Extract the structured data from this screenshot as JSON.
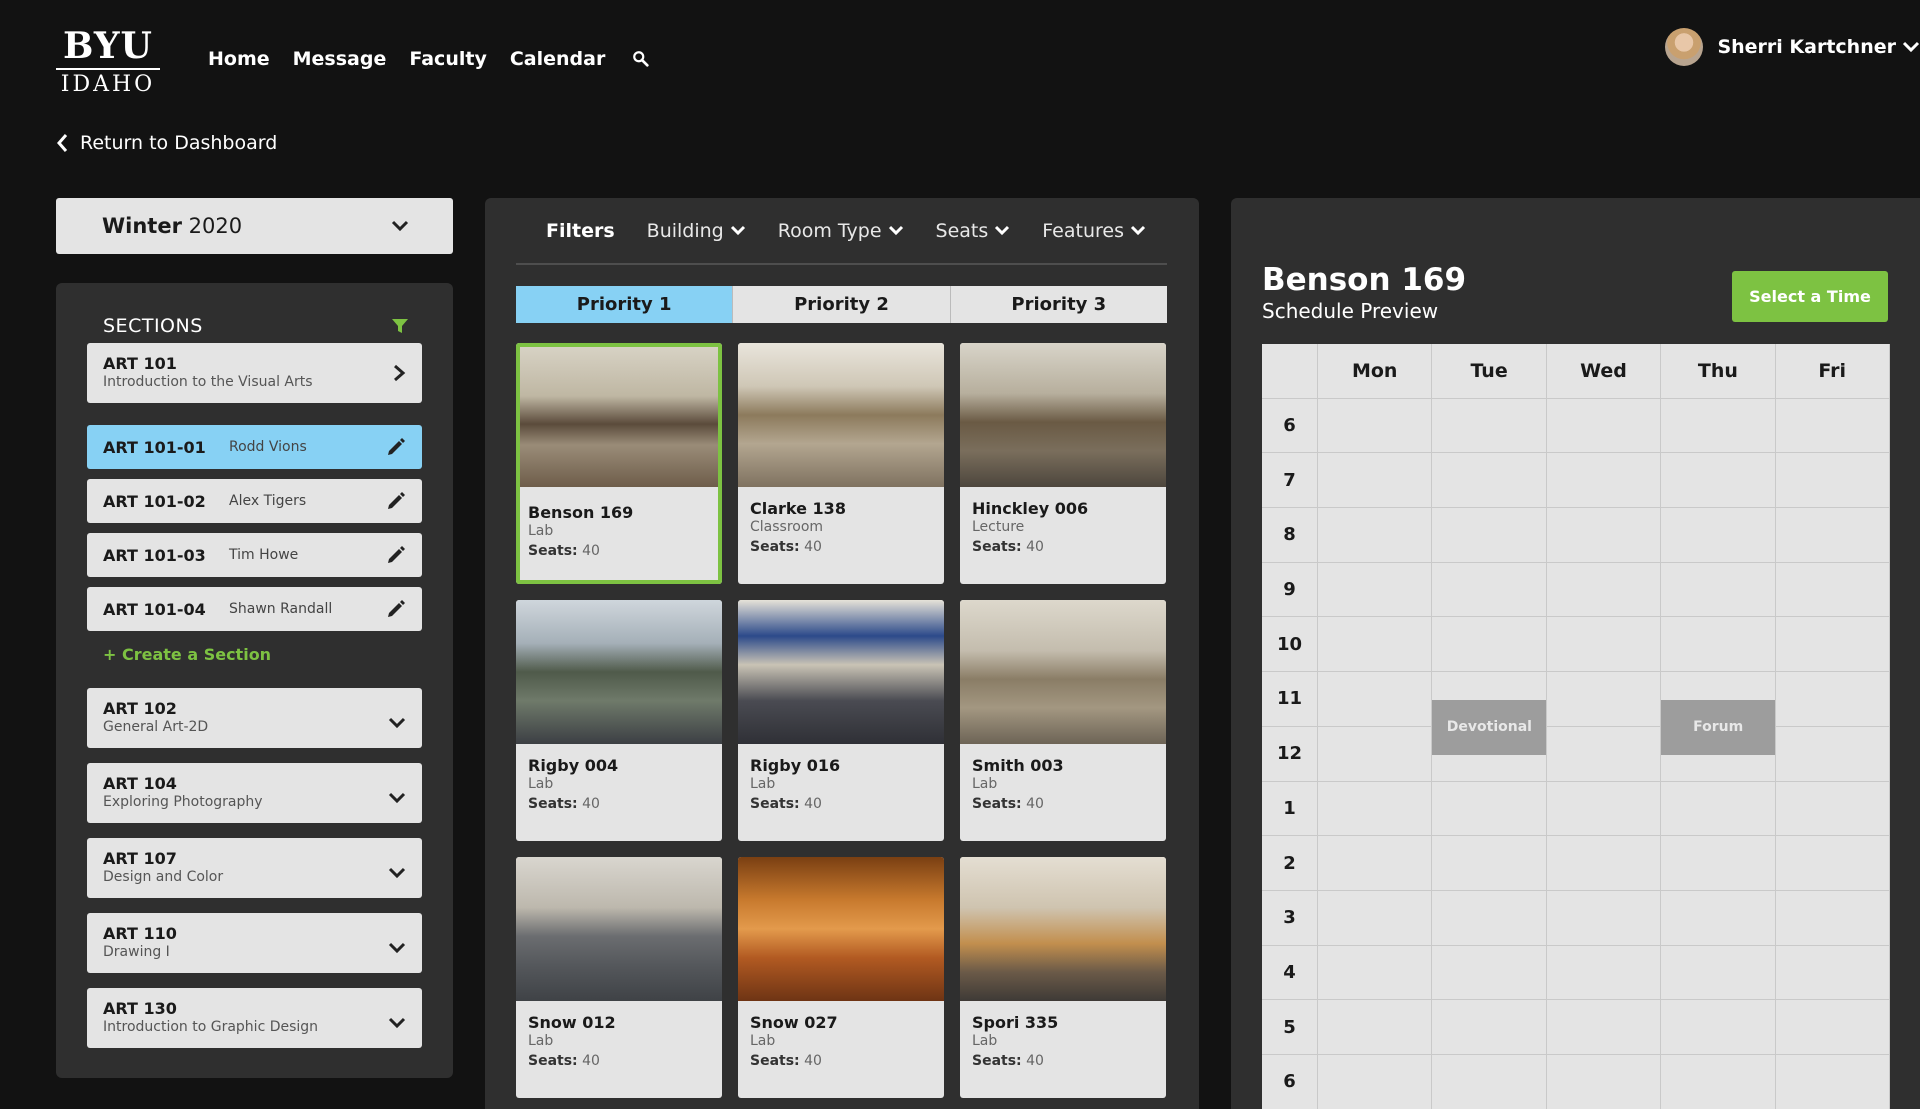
{
  "header": {
    "logo_line1": "BYU",
    "logo_line2": "IDAHO",
    "nav": [
      "Home",
      "Message",
      "Faculty",
      "Calendar"
    ],
    "user_name": "Sherri Kartchner"
  },
  "back_label": "Return to Dashboard",
  "semester": {
    "term": "Winter",
    "year": "2020"
  },
  "sections_panel": {
    "title": "SECTIONS",
    "open_course": {
      "code": "ART 101",
      "name": "Introduction to the Visual Arts"
    },
    "subsections": [
      {
        "code": "ART 101-01",
        "instructor": "Rodd Vions"
      },
      {
        "code": "ART 101-02",
        "instructor": "Alex Tigers"
      },
      {
        "code": "ART 101-03",
        "instructor": "Tim Howe"
      },
      {
        "code": "ART 101-04",
        "instructor": "Shawn Randall"
      }
    ],
    "create_label": "+ Create a Section",
    "courses": [
      {
        "code": "ART 102",
        "name": "General Art-2D"
      },
      {
        "code": "ART 104",
        "name": "Exploring Photography"
      },
      {
        "code": "ART 107",
        "name": "Design and Color"
      },
      {
        "code": "ART 110",
        "name": "Drawing I"
      },
      {
        "code": "ART 130",
        "name": "Introduction to Graphic Design"
      }
    ]
  },
  "filters": {
    "label": "Filters",
    "dropdowns": [
      "Building",
      "Room Type",
      "Seats",
      "Features"
    ]
  },
  "priority_tabs": [
    "Priority 1",
    "Priority 2",
    "Priority 3"
  ],
  "seats_label": "Seats:",
  "rooms": [
    {
      "name": "Benson 169",
      "type": "Lab",
      "seats": "40"
    },
    {
      "name": "Clarke 138",
      "type": "Classroom",
      "seats": "40"
    },
    {
      "name": "Hinckley 006",
      "type": "Lecture",
      "seats": "40"
    },
    {
      "name": "Rigby 004",
      "type": "Lab",
      "seats": "40"
    },
    {
      "name": "Rigby 016",
      "type": "Lab",
      "seats": "40"
    },
    {
      "name": "Smith 003",
      "type": "Lab",
      "seats": "40"
    },
    {
      "name": "Snow 012",
      "type": "Lab",
      "seats": "40"
    },
    {
      "name": "Snow 027",
      "type": "Lab",
      "seats": "40"
    },
    {
      "name": "Spori 335",
      "type": "Lab",
      "seats": "40"
    }
  ],
  "schedule": {
    "room": "Benson 169",
    "subtitle": "Schedule Preview",
    "select_label": "Select a Time",
    "days": [
      "Mon",
      "Tue",
      "Wed",
      "Thu",
      "Fri"
    ],
    "hours": [
      "6",
      "7",
      "8",
      "9",
      "10",
      "11",
      "12",
      "1",
      "2",
      "3",
      "4",
      "5",
      "6"
    ],
    "events": [
      {
        "label": "Devotional",
        "day": "Tue",
        "start_hour": "11:30"
      },
      {
        "label": "Forum",
        "day": "Thu",
        "start_hour": "11:30"
      }
    ]
  },
  "colors": {
    "accent_green": "#7dc242",
    "accent_blue": "#87d1f4",
    "panel": "#2f2f2f",
    "background": "#121212"
  }
}
